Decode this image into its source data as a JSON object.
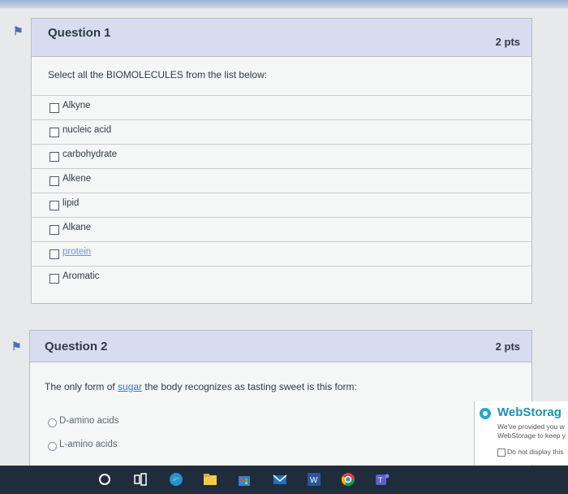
{
  "quiz": {
    "q1": {
      "title": "Question 1",
      "points": "2 pts",
      "prompt": "Select all the BIOMOLECULES from the list below:",
      "answers": [
        "Alkyne",
        "nucleic acid",
        "carbohydrate",
        "Alkene",
        "lipid",
        "Alkane",
        "protein",
        "Aromatic"
      ]
    },
    "q2": {
      "title": "Question 2",
      "points": "2 pts",
      "prompt_before": "The only form of ",
      "prompt_link": "sugar",
      "prompt_after": " the body recognizes as tasting sweet is this form:",
      "options": [
        "D-amino acids",
        "L-amino acids"
      ]
    }
  },
  "popup": {
    "name": "WebStorag",
    "line1": "We've provided you w",
    "line2": "WebStorage to keep y",
    "checkbox_label": "Do not display this"
  },
  "taskbar": {
    "icons": [
      "search-icon",
      "task-view-icon",
      "edge-icon",
      "file-explorer-icon",
      "store-icon",
      "mail-icon",
      "word-icon",
      "chrome-icon",
      "teams-icon"
    ]
  },
  "colors": {
    "question_header": "#d8dcf0",
    "page_bg": "#e7e9ea",
    "taskbar": "#1f2c3c",
    "link": "#3b73c4"
  }
}
